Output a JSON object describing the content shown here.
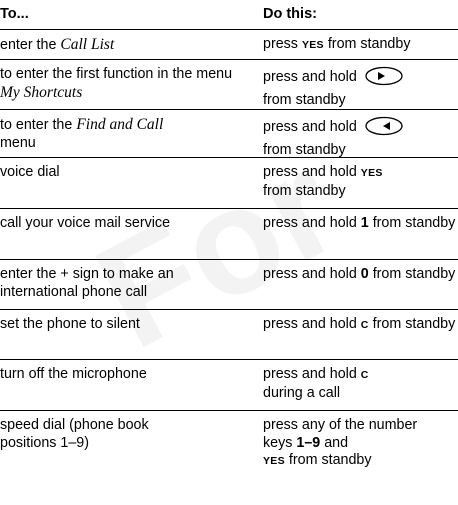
{
  "watermark": "For",
  "header": {
    "col_to": "To...",
    "col_do": "Do this:"
  },
  "rows": [
    {
      "to": {
        "a": "enter the ",
        "b": "Call List"
      },
      "do": {
        "a": "press ",
        "k": "YES",
        "b": " from standby"
      }
    },
    {
      "to": {
        "a": "to enter the first function in the menu ",
        "b": "My Shortcuts"
      },
      "do": {
        "a": "press and hold",
        "icon": "navigation-key-right-icon",
        "b": "from standby"
      }
    },
    {
      "to": {
        "a": "to enter the ",
        "b": "Find and Call",
        "c": " menu"
      },
      "do": {
        "a": "press and hold",
        "icon": "navigation-key-left-icon",
        "b": "from standby"
      }
    },
    {
      "to": {
        "a": "voice dial"
      },
      "do": {
        "a": "press and hold ",
        "k": "YES",
        "b": "from standby"
      }
    },
    {
      "to": {
        "a": "call your voice mail service"
      },
      "do": {
        "a": "press and hold ",
        "n": "1",
        "b": " from standby"
      }
    },
    {
      "to": {
        "a": "enter the + sign to make an international phone call"
      },
      "do": {
        "a": "press and hold ",
        "n": "0",
        "b": " from standby"
      }
    },
    {
      "to": {
        "a": "set the phone to silent"
      },
      "do": {
        "a": "press and hold ",
        "k": "C",
        "b": " from standby"
      }
    },
    {
      "to": {
        "a": "turn off the microphone"
      },
      "do": {
        "a": "press and hold ",
        "k": "C",
        "b": "during a call"
      }
    },
    {
      "to": {
        "a": "speed dial (phone book positions 1–9)"
      },
      "do": {
        "a": "press any of the number keys ",
        "n": "1–9",
        "b": " and ",
        "k": "YES",
        "c": " from standby"
      }
    }
  ]
}
